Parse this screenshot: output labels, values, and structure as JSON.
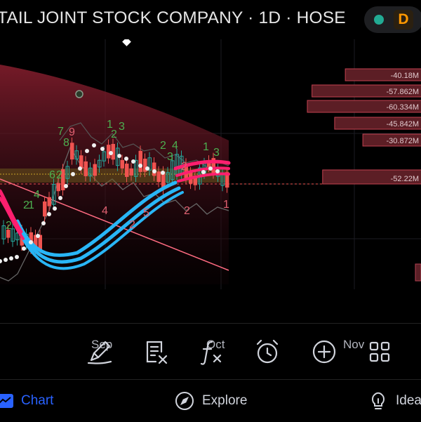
{
  "header": {
    "title": "TAIL JOINT STOCK COMPANY · 1D · HOSE",
    "interval_badge": "D",
    "status_color": "#22ab94"
  },
  "chart": {
    "x_axis_labels": [
      "Sep",
      "Oct",
      "Nov"
    ],
    "volume_profile": [
      {
        "label": "-40.18M",
        "value": 40.18
      },
      {
        "label": "-57.862M",
        "value": 57.862
      },
      {
        "label": "-60.334M",
        "value": 60.334
      },
      {
        "label": "-45.842M",
        "value": 45.842
      },
      {
        "label": "-30.872M",
        "value": 30.872
      },
      {
        "label": "-52.22M",
        "value": 52.22
      }
    ],
    "signal_labels": [
      "7",
      "9",
      "8",
      "1",
      "3",
      "2",
      "2",
      "4",
      "3",
      "1",
      "3",
      "2",
      "6",
      "2",
      "4",
      "1",
      "2",
      "2",
      "4",
      "5",
      "2",
      "1",
      "2"
    ],
    "colors": {
      "up_candle": "#26a69a",
      "down_candle": "#ef5350",
      "magenta_band": "#ff1f6f",
      "cyan_band": "#29b6f6",
      "price_line": "#ef5350",
      "trend_line": "#ff6b81"
    }
  },
  "toolbar": {
    "tools": [
      {
        "name": "draw-tool-icon"
      },
      {
        "name": "object-tree-icon"
      },
      {
        "name": "indicators-icon"
      },
      {
        "name": "alert-icon"
      },
      {
        "name": "add-icon"
      },
      {
        "name": "apps-grid-icon"
      }
    ]
  },
  "nav": {
    "chart_label": "Chart",
    "explore_label": "Explore",
    "ideas_label": "Ideas",
    "active_color": "#2962ff"
  }
}
